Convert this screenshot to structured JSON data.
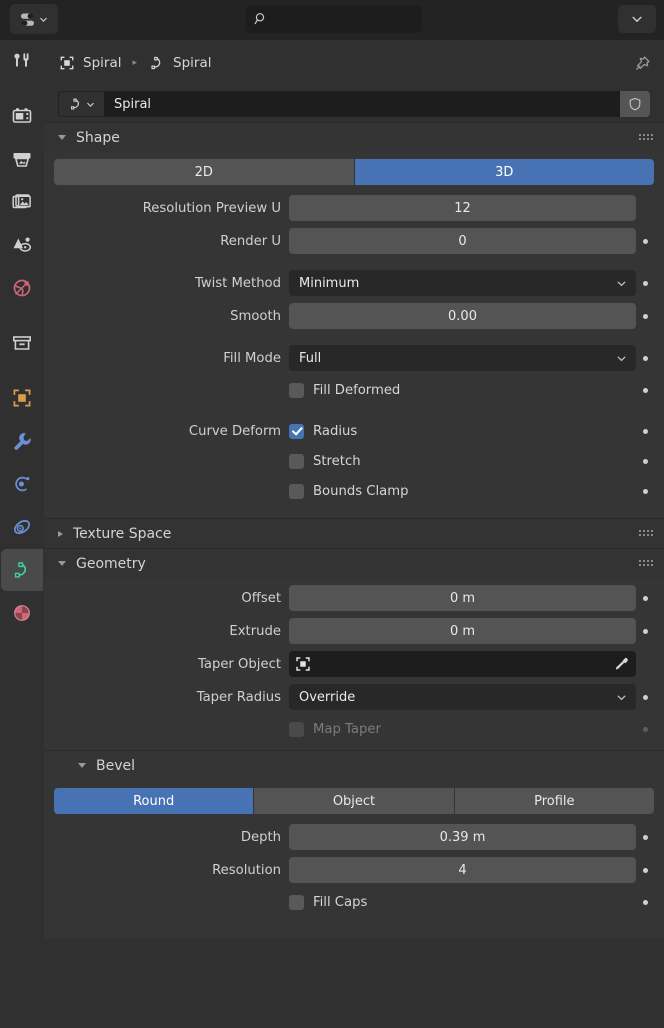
{
  "topbar": {
    "editor_type_icon": "properties-editor-icon",
    "editor_type_chevron": "chevron-down-icon",
    "search_placeholder": "",
    "search_value": "",
    "search_icon": "search-icon",
    "dropdown_icon": "chevron-down-icon"
  },
  "breadcrumb": {
    "object_icon": "object-data-icon",
    "object_name": "Spiral",
    "separator": "▸",
    "curve_icon": "curve-data-icon",
    "curve_name": "Spiral",
    "pin_icon": "pin-icon"
  },
  "idblock": {
    "type_icon": "curve-data-icon",
    "type_chevron": "chevron-down-icon",
    "name": "Spiral",
    "fake_user_icon": "shield-icon"
  },
  "navbar": {
    "items": [
      {
        "name": "tool",
        "icon": "tool-icon",
        "active": false,
        "color": "#d0d0d0",
        "gap_after": true
      },
      {
        "name": "render",
        "icon": "render-camera-icon",
        "active": false,
        "color": "#d0d0d0",
        "gap_after": false
      },
      {
        "name": "output",
        "icon": "printer-icon",
        "active": false,
        "color": "#d0d0d0",
        "gap_after": false
      },
      {
        "name": "view-layer",
        "icon": "images-icon",
        "active": false,
        "color": "#d0d0d0",
        "gap_after": false
      },
      {
        "name": "scene",
        "icon": "scene-cone-icon",
        "active": false,
        "color": "#d0d0d0",
        "gap_after": false
      },
      {
        "name": "world",
        "icon": "world-globe-icon",
        "active": false,
        "color": "#cc6678",
        "gap_after": true
      },
      {
        "name": "collection",
        "icon": "collection-box-icon",
        "active": false,
        "color": "#d0d0d0",
        "gap_after": true
      },
      {
        "name": "object",
        "icon": "object-square-icon",
        "active": false,
        "color": "#e09b4a",
        "gap_after": false
      },
      {
        "name": "modifiers",
        "icon": "wrench-icon",
        "active": false,
        "color": "#6b8fd4",
        "gap_after": false
      },
      {
        "name": "particles",
        "icon": "particles-icon",
        "active": false,
        "color": "#6b8fd4",
        "gap_after": false
      },
      {
        "name": "physics",
        "icon": "physics-orbit-icon",
        "active": false,
        "color": "#6b8fd4",
        "gap_after": false
      },
      {
        "name": "object-data-curve",
        "icon": "curve-data-icon",
        "active": true,
        "color": "#3ccfa0",
        "gap_after": false
      },
      {
        "name": "material",
        "icon": "material-sphere-icon",
        "active": false,
        "color": "#cc6678",
        "gap_after": false
      }
    ]
  },
  "panels": {
    "shape": {
      "title": "Shape",
      "open": true,
      "dimension_toggle": {
        "options": [
          "2D",
          "3D"
        ],
        "selected": "3D"
      },
      "rows": [
        {
          "label": "Resolution Preview U",
          "value": "12",
          "type": "number",
          "decorator": "none"
        },
        {
          "label": "Render U",
          "value": "0",
          "type": "number",
          "decorator": "on"
        },
        {
          "label": "Twist Method",
          "value": "Minimum",
          "type": "dropdown",
          "decorator": "on"
        },
        {
          "label": "Smooth",
          "value": "0.00",
          "type": "number",
          "decorator": "on"
        },
        {
          "label": "Fill Mode",
          "value": "Full",
          "type": "dropdown",
          "decorator": "on"
        }
      ],
      "checkboxes": [
        {
          "label": "",
          "option": "Fill Deformed",
          "checked": false,
          "decorator": "on",
          "enabled": true
        },
        {
          "label": "Curve Deform",
          "option": "Radius",
          "checked": true,
          "decorator": "on",
          "enabled": true
        },
        {
          "label": "",
          "option": "Stretch",
          "checked": false,
          "decorator": "on",
          "enabled": true
        },
        {
          "label": "",
          "option": "Bounds Clamp",
          "checked": false,
          "decorator": "on",
          "enabled": true
        }
      ]
    },
    "texture_space": {
      "title": "Texture Space",
      "open": false
    },
    "geometry": {
      "title": "Geometry",
      "open": true,
      "rows": [
        {
          "label": "Offset",
          "value": "0 m",
          "type": "number",
          "decorator": "on"
        },
        {
          "label": "Extrude",
          "value": "0 m",
          "type": "number",
          "decorator": "on"
        },
        {
          "label": "Taper Object",
          "value": "",
          "type": "object",
          "decorator": "none"
        },
        {
          "label": "Taper Radius",
          "value": "Override",
          "type": "dropdown",
          "decorator": "on"
        }
      ],
      "checkboxes": [
        {
          "label": "",
          "option": "Map Taper",
          "checked": false,
          "decorator": "dim",
          "enabled": false
        }
      ],
      "object_field_icons": {
        "left": "object-square-icon",
        "right": "eyedropper-icon"
      }
    },
    "bevel": {
      "title": "Bevel",
      "open": true,
      "type_toggle": {
        "options": [
          "Round",
          "Object",
          "Profile"
        ],
        "selected": "Round"
      },
      "rows": [
        {
          "label": "Depth",
          "value": "0.39 m",
          "type": "number",
          "decorator": "on"
        },
        {
          "label": "Resolution",
          "value": "4",
          "type": "number",
          "decorator": "on"
        }
      ],
      "checkboxes": [
        {
          "label": "",
          "option": "Fill Caps",
          "checked": false,
          "decorator": "on",
          "enabled": true
        }
      ]
    }
  },
  "colors": {
    "accent_blue": "#4772b3",
    "panel_bg": "#353535",
    "header_bg": "#333333",
    "editor_bg": "#303030",
    "topbar_bg": "#232323",
    "field_bg": "#545454",
    "dark_field_bg": "#1d1d1d"
  }
}
